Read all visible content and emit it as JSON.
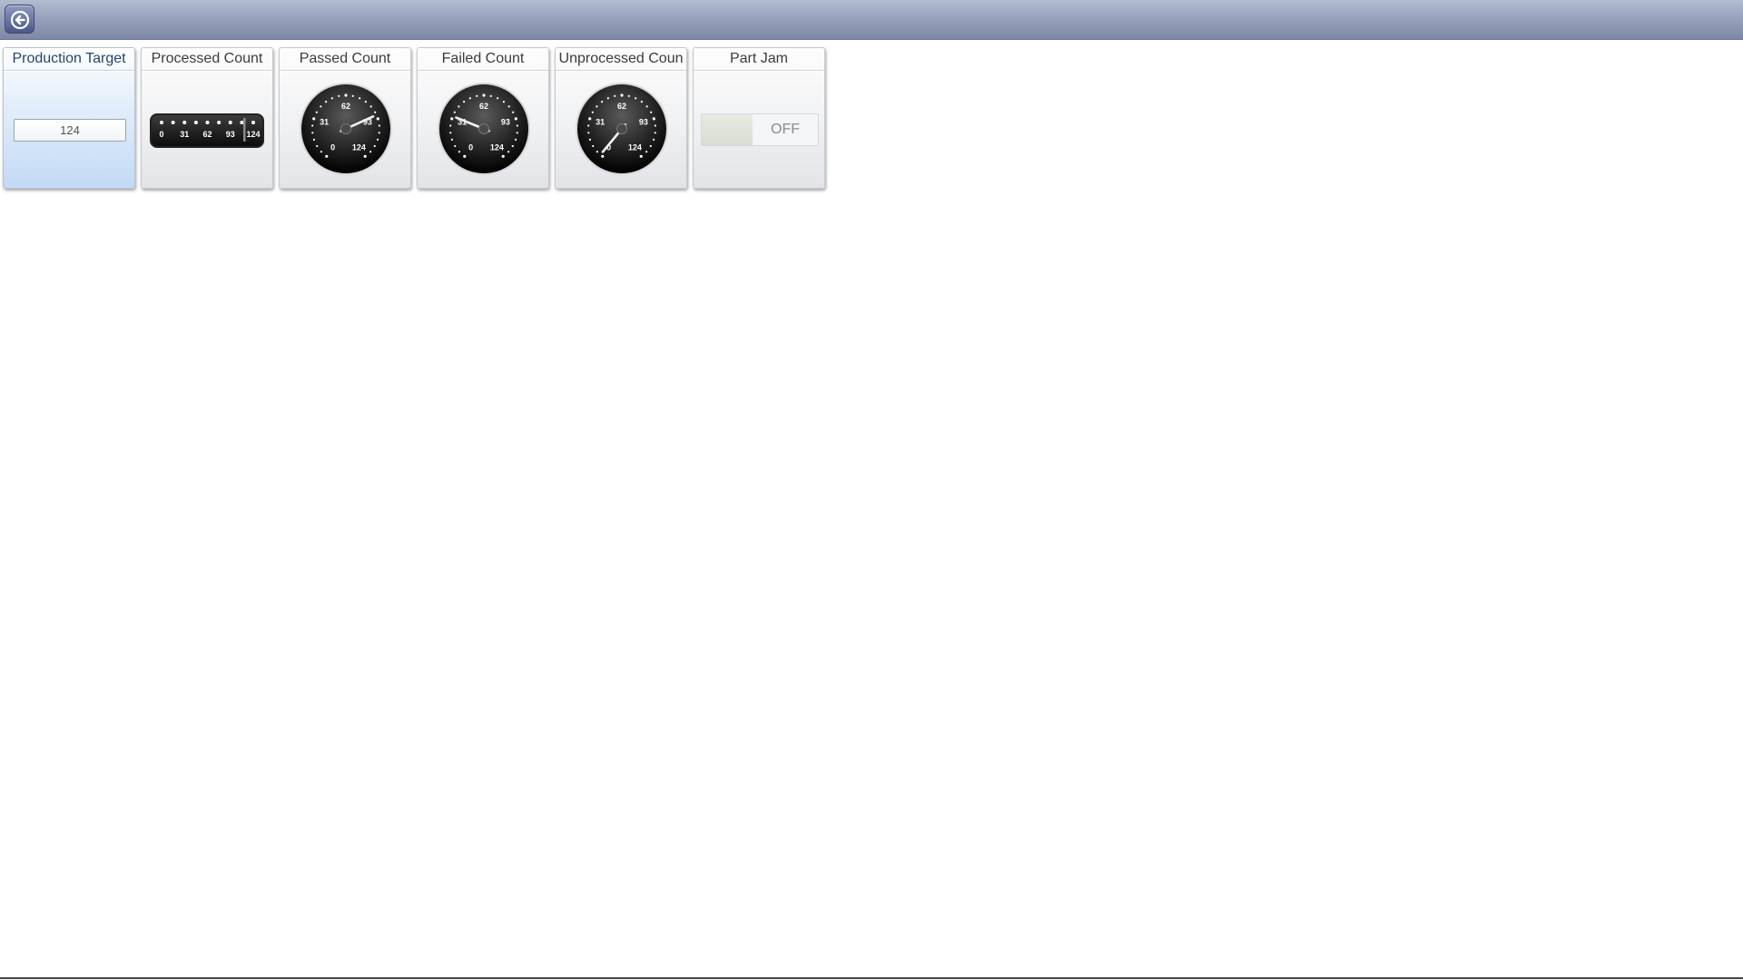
{
  "toolbar": {
    "back_icon": "arrow-left-circle-icon"
  },
  "panels": [
    {
      "title": "Production Target",
      "widget": "numeric-input",
      "value": "124",
      "active": true
    },
    {
      "title": "Processed Count",
      "widget": "linear-gauge",
      "ticks": [
        "0",
        "31",
        "62",
        "93",
        "124"
      ],
      "value": 124
    },
    {
      "title": "Passed Count",
      "widget": "radial-gauge",
      "ticks": [
        "0",
        "31",
        "62",
        "93",
        "124"
      ],
      "value": 90
    },
    {
      "title": "Failed Count",
      "widget": "radial-gauge",
      "ticks": [
        "0",
        "31",
        "62",
        "93",
        "124"
      ],
      "value": 33
    },
    {
      "title": "Unprocessed Coun",
      "widget": "radial-gauge",
      "ticks": [
        "0",
        "31",
        "62",
        "93",
        "124"
      ],
      "value": 2
    },
    {
      "title": "Part Jam",
      "widget": "toggle",
      "state": "OFF"
    }
  ]
}
